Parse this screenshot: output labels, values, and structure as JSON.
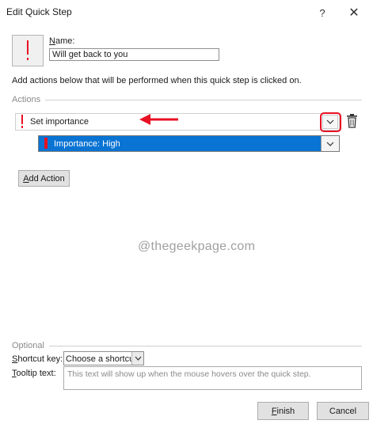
{
  "window": {
    "title": "Edit Quick Step",
    "help_glyph": "?",
    "close_glyph": "✕"
  },
  "name_section": {
    "label_first": "N",
    "label_rest": "ame:",
    "value": "Will get back to you",
    "icon": "red-exclamation-icon"
  },
  "description": "Add actions below that will be performed when this quick step is clicked on.",
  "actions_group": {
    "label": "Actions",
    "action": {
      "text": "Set importance",
      "icon": "red-exclamation-icon"
    },
    "sub_option": {
      "text": "Importance: High"
    },
    "add_action_first": "A",
    "add_action_rest": "dd Action"
  },
  "watermark": "@thegeekpage.com",
  "optional_group": {
    "label": "Optional",
    "shortcut_label_first": "S",
    "shortcut_label_rest": "hortcut key:",
    "shortcut_value": "Choose a shortcut",
    "tooltip_label_first": "T",
    "tooltip_label_rest": "ooltip text:",
    "tooltip_placeholder": "This text will show up when the mouse hovers over the quick step."
  },
  "buttons": {
    "finish_first": "F",
    "finish_rest": "inish",
    "cancel": "Cancel"
  },
  "colors": {
    "accent_blue": "#0a74d4",
    "alert_red": "#e81123"
  }
}
